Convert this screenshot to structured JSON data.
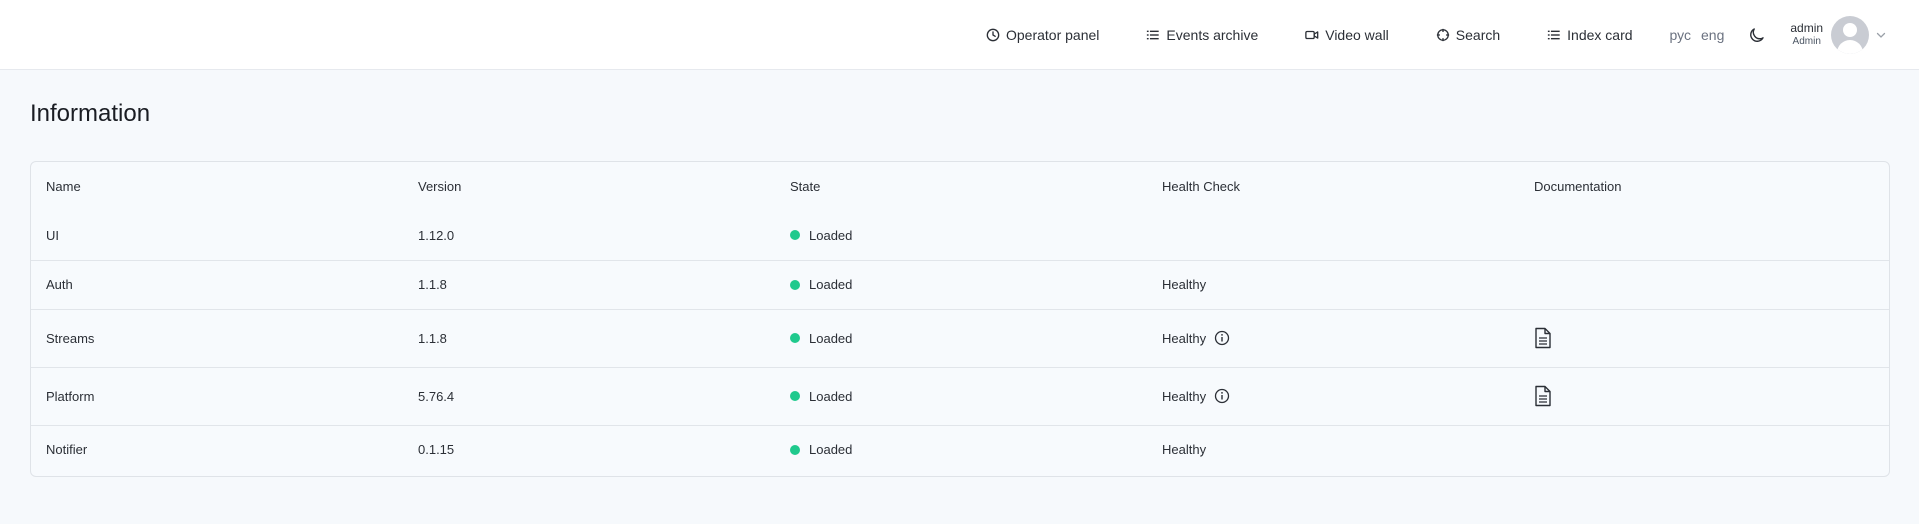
{
  "nav": {
    "operator_panel": "Operator panel",
    "events_archive": "Events archive",
    "video_wall": "Video wall",
    "search": "Search",
    "index_card": "Index card"
  },
  "languages": {
    "ru": "рус",
    "en": "eng"
  },
  "user": {
    "name": "admin",
    "role": "Admin"
  },
  "page": {
    "title": "Information"
  },
  "table": {
    "headers": {
      "name": "Name",
      "version": "Version",
      "state": "State",
      "health": "Health Check",
      "docs": "Documentation"
    },
    "rows": [
      {
        "name": "UI",
        "version": "1.12.0",
        "state": "Loaded",
        "health": "",
        "health_info": false,
        "docs": false
      },
      {
        "name": "Auth",
        "version": "1.1.8",
        "state": "Loaded",
        "health": "Healthy",
        "health_info": false,
        "docs": false
      },
      {
        "name": "Streams",
        "version": "1.1.8",
        "state": "Loaded",
        "health": "Healthy",
        "health_info": true,
        "docs": true
      },
      {
        "name": "Platform",
        "version": "5.76.4",
        "state": "Loaded",
        "health": "Healthy",
        "health_info": true,
        "docs": true
      },
      {
        "name": "Notifier",
        "version": "0.1.15",
        "state": "Loaded",
        "health": "Healthy",
        "health_info": false,
        "docs": false
      }
    ]
  },
  "colors": {
    "state_loaded": "#1fc98d"
  },
  "icons": {
    "operator_panel": "clock-icon",
    "events_archive": "list-icon",
    "video_wall": "video-camera-icon",
    "search": "crosshair-icon",
    "index_card": "list-icon",
    "theme": "moon-icon",
    "health_info": "info-icon",
    "docs": "document-icon"
  }
}
